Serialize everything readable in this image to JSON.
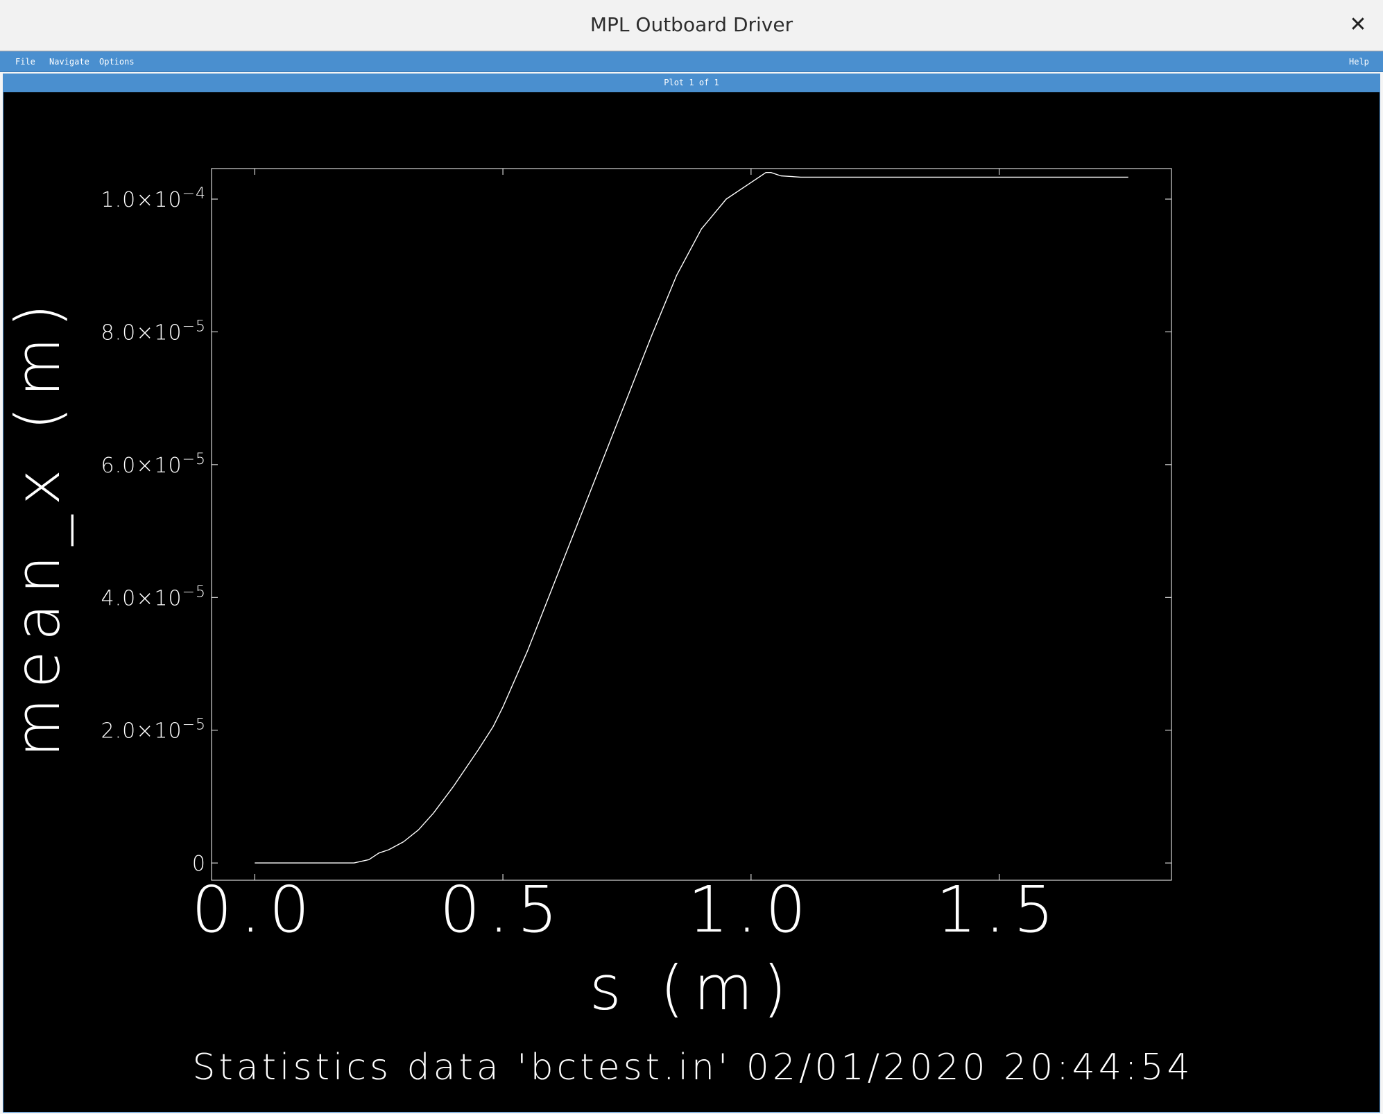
{
  "window": {
    "title": "MPL Outboard Driver",
    "close_label": "✕"
  },
  "menubar": {
    "file": "File",
    "navigate": "Navigate",
    "options": "Options",
    "help": "Help"
  },
  "plotbar": {
    "label": "Plot 1 of 1"
  },
  "footer": {
    "caption": "Statistics data 'bctest.in' 02/01/2020 20:44:54"
  },
  "colors": {
    "menubar": "#4a8fcf",
    "plot_background": "#000000",
    "line": "#ffffff"
  },
  "chart_data": {
    "type": "line",
    "title": "",
    "xlabel": "s (m)",
    "ylabel": "mean_x (m)",
    "xlim": [
      -0.087,
      1.847
    ],
    "ylim": [
      -2.6e-06,
      0.0001046
    ],
    "grid": false,
    "x_ticks": [
      {
        "value": 0.0,
        "label": "0.0"
      },
      {
        "value": 0.5,
        "label": "0.5"
      },
      {
        "value": 1.0,
        "label": "1.0"
      },
      {
        "value": 1.5,
        "label": "1.5"
      }
    ],
    "y_ticks": [
      {
        "value": 0,
        "mantissa": "0",
        "exponent": ""
      },
      {
        "value": 2e-05,
        "mantissa": "2.0×10",
        "exponent": "−5"
      },
      {
        "value": 4e-05,
        "mantissa": "4.0×10",
        "exponent": "−5"
      },
      {
        "value": 6e-05,
        "mantissa": "6.0×10",
        "exponent": "−5"
      },
      {
        "value": 8e-05,
        "mantissa": "8.0×10",
        "exponent": "−5"
      },
      {
        "value": 0.0001,
        "mantissa": "1.0×10",
        "exponent": "−4"
      }
    ],
    "series": [
      {
        "x": [
          0.0,
          0.1,
          0.2,
          0.23,
          0.25,
          0.27,
          0.3,
          0.33,
          0.36,
          0.4,
          0.45,
          0.48,
          0.5,
          0.55,
          0.6,
          0.65,
          0.7,
          0.75,
          0.8,
          0.85,
          0.9,
          0.95,
          1.0,
          1.03,
          1.04,
          1.06,
          1.1,
          1.2,
          1.4,
          1.6,
          1.76
        ],
        "y": [
          0,
          0,
          0,
          5e-07,
          1.5e-06,
          2e-06,
          3.2e-06,
          5e-06,
          7.5e-06,
          1.15e-05,
          1.7e-05,
          2.05e-05,
          2.35e-05,
          3.2e-05,
          4.15e-05,
          5.1e-05,
          6.05e-05,
          7e-05,
          7.95e-05,
          8.85e-05,
          9.55e-05,
          0.0001,
          0.0001025,
          0.000104,
          0.000104,
          0.0001035,
          0.0001033,
          0.0001033,
          0.0001033,
          0.0001033,
          0.0001033
        ]
      }
    ]
  }
}
